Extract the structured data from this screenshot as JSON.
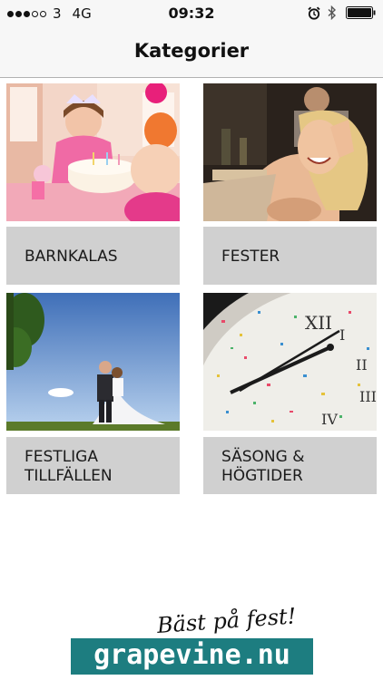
{
  "status_bar": {
    "signal_bars_filled": 3,
    "signal_bars_total": 5,
    "carrier": "3",
    "network": "4G",
    "time": "09:32",
    "icons": [
      "alarm-icon",
      "bluetooth-icon",
      "battery-icon"
    ]
  },
  "nav": {
    "title": "Kategorier"
  },
  "categories": [
    {
      "label": "BARNKALAS",
      "image": "birthday-party-photo"
    },
    {
      "label": "FESTER",
      "image": "laughing-woman-photo"
    },
    {
      "label": "FESTLIGA\nTILLFÄLLEN",
      "image": "wedding-couple-photo"
    },
    {
      "label": "SÄSONG &\nHÖGTIDER",
      "image": "clock-confetti-photo"
    }
  ],
  "footer": {
    "tagline": "Bäst på fest!",
    "brand": "grapevine.nu"
  },
  "colors": {
    "tile_label_bg": "#d0d0d0",
    "brand_bg": "#1d7d80",
    "bar_bg": "#f7f7f7"
  }
}
